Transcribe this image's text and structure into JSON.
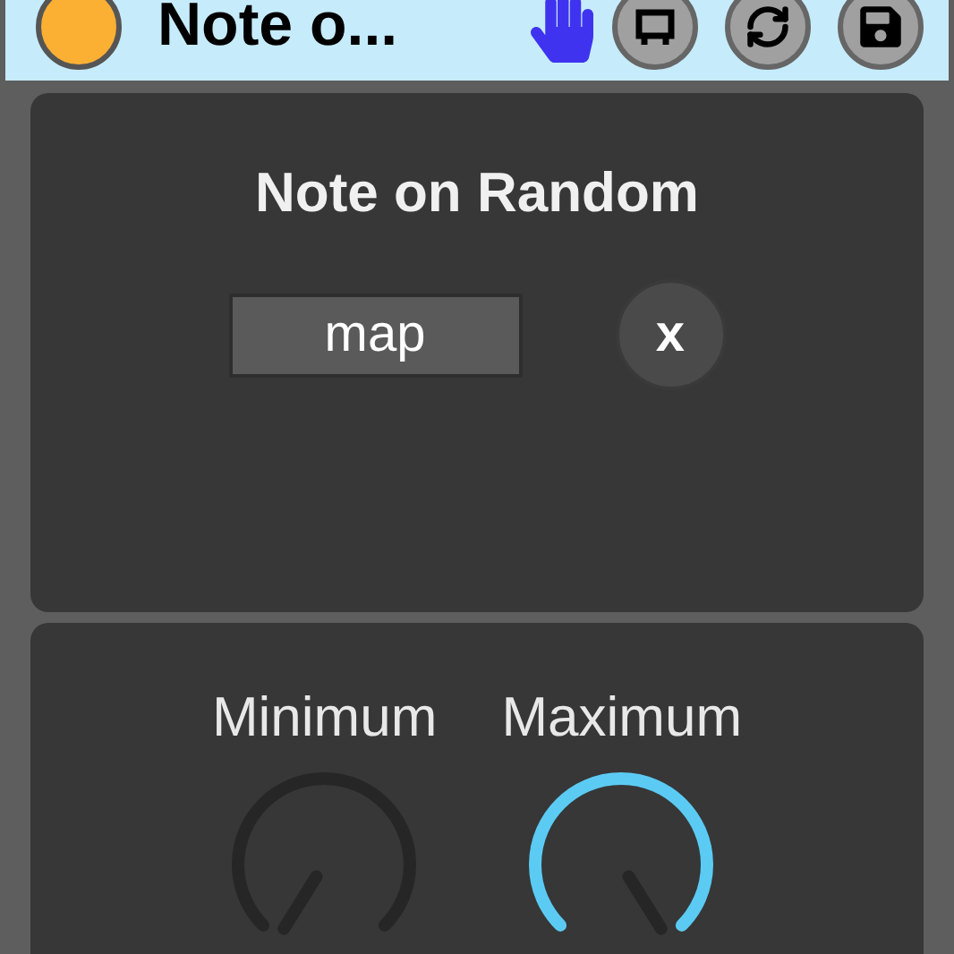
{
  "title_bar": {
    "title": "Note o..."
  },
  "device": {
    "title": "Note on Random",
    "map_button": "map",
    "close_button": "x"
  },
  "knobs": [
    {
      "label": "Minimum"
    },
    {
      "label": "Maximum"
    }
  ]
}
